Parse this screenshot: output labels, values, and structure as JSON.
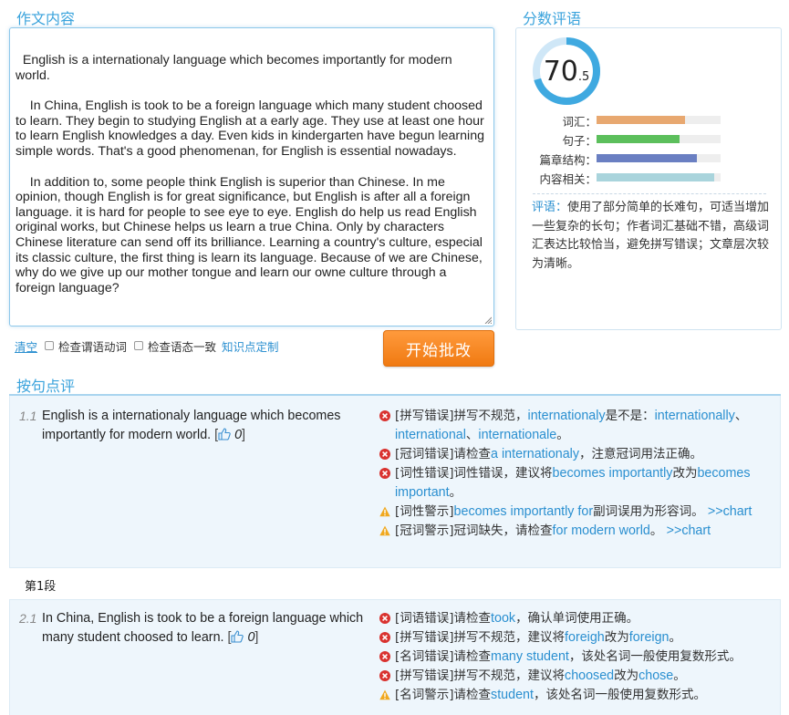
{
  "sections": {
    "essay_title": "作文内容",
    "score_title": "分数评语",
    "review_title": "按句点评"
  },
  "essay": {
    "paragraphs": [
      "  English is a internationaly language which becomes importantly for modern world.",
      "    In China, English is took to be a foreign language which many student choosed to learn. They begin to studying English at a early age. They use at least one hour to learn English knowledges a day. Even kids in kindergarten have begun learning simple words. That's a good phenomenan, for English is essential nowadays.",
      "    In addition to, some people think English is superior than Chinese. In me opinion, though English is for great significance, but English is after all a foreign language. it is hard for people to see eye to eye. English do help us read English original works, but Chinese helps us learn a true China. Only by characters Chinese literature can send off its brilliance. Learning a country's culture, especial its classic culture, the first thing is learn its language. Because of we are Chinese, why do we give up our mother tongue and learn our owne culture through a foreign language?"
    ]
  },
  "toolbar": {
    "clear": "清空",
    "check_verb": "检查谓语动词",
    "check_voice": "检查语态一致",
    "custom": "知识点定制",
    "start": "开始批改"
  },
  "score": {
    "integer": "70",
    "decimal": ".5",
    "fraction": 0.705,
    "ring_color": "#3fa9e0",
    "ring_bg": "#cfe7f7",
    "metrics": [
      {
        "label": "词汇：",
        "value": 0.71,
        "color": "#e8a870"
      },
      {
        "label": "句子：",
        "value": 0.67,
        "color": "#5cbf5c"
      },
      {
        "label": "篇章结构：",
        "value": 0.81,
        "color": "#6a7fc2"
      },
      {
        "label": "内容相关：",
        "value": 0.95,
        "color": "#a9d4dc"
      }
    ],
    "comment_key": "评语：",
    "comment_text": "使用了部分简单的长难句，可适当增加一些复杂的长句；作者词汇基础不错，高级词汇表达比较恰当，避免拼写错误；文章层次较为清晰。"
  },
  "review": {
    "blocks": [
      {
        "num": "1.1",
        "sentence": "English is a internationaly language which becomes importantly for modern world.",
        "votes": "0",
        "notes": [
          {
            "type": "error",
            "parts": [
              [
                "t",
                "[拼写错误]拼写不规范，"
              ],
              [
                "h",
                "internationaly"
              ],
              [
                "t",
                "是不是："
              ],
              [
                "h",
                "internationally"
              ],
              [
                "t",
                "、"
              ],
              [
                "h",
                "international"
              ],
              [
                "t",
                "、"
              ],
              [
                "h",
                "internationale"
              ],
              [
                "t",
                "。"
              ]
            ]
          },
          {
            "type": "error",
            "parts": [
              [
                "t",
                "[冠词错误]请检查"
              ],
              [
                "h",
                "a internationaly"
              ],
              [
                "t",
                "，注意冠词用法正确。"
              ]
            ]
          },
          {
            "type": "error",
            "parts": [
              [
                "t",
                "[词性错误]词性错误，建议将"
              ],
              [
                "h",
                "becomes importantly"
              ],
              [
                "t",
                "改为"
              ],
              [
                "h",
                "becomes important"
              ],
              [
                "t",
                "。"
              ]
            ]
          },
          {
            "type": "warn",
            "parts": [
              [
                "t",
                "[词性警示]"
              ],
              [
                "h",
                "becomes importantly for"
              ],
              [
                "t",
                "副词误用为形容词。 "
              ],
              [
                "h",
                ">>chart"
              ]
            ]
          },
          {
            "type": "warn",
            "parts": [
              [
                "t",
                "[冠词警示]冠词缺失，请检查"
              ],
              [
                "h",
                "for modern world"
              ],
              [
                "t",
                "。 "
              ],
              [
                "h",
                ">>chart"
              ]
            ]
          }
        ]
      },
      {
        "num": "2.1",
        "sentence": "In China, English is took to be a foreign language which many student choosed to learn.",
        "votes": "0",
        "notes": [
          {
            "type": "error",
            "parts": [
              [
                "t",
                "[词语错误]请检查"
              ],
              [
                "h",
                "took"
              ],
              [
                "t",
                "，确认单词使用正确。"
              ]
            ]
          },
          {
            "type": "error",
            "parts": [
              [
                "t",
                "[拼写错误]拼写不规范，建议将"
              ],
              [
                "h",
                "foreigh"
              ],
              [
                "t",
                "改为"
              ],
              [
                "h",
                "foreign"
              ],
              [
                "t",
                "。"
              ]
            ]
          },
          {
            "type": "error",
            "parts": [
              [
                "t",
                "[名词错误]请检查"
              ],
              [
                "h",
                "many student"
              ],
              [
                "t",
                "，该处名词一般使用复数形式。"
              ]
            ]
          },
          {
            "type": "error",
            "parts": [
              [
                "t",
                "[拼写错误]拼写不规范，建议将"
              ],
              [
                "h",
                "choosed"
              ],
              [
                "t",
                "改为"
              ],
              [
                "h",
                "chose"
              ],
              [
                "t",
                "。"
              ]
            ]
          },
          {
            "type": "warn",
            "parts": [
              [
                "t",
                "[名词警示]请检查"
              ],
              [
                "h",
                "student"
              ],
              [
                "t",
                "，该处名词一般使用复数形式。"
              ]
            ]
          }
        ]
      }
    ],
    "paragraph_label": "第1段"
  }
}
